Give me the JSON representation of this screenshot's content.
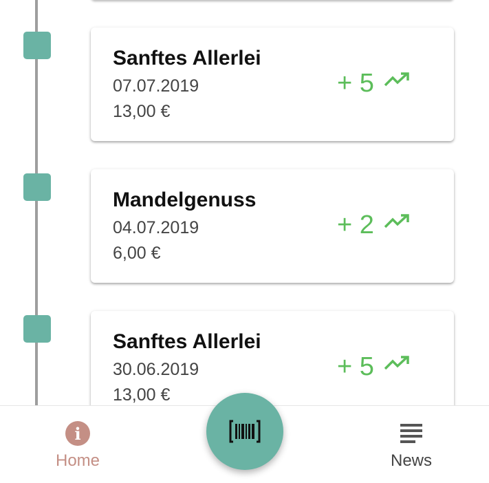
{
  "timeline": {
    "entries": [
      {
        "title": "Sanftes Allerlei",
        "date": "07.07.2019",
        "price": "13,00 €",
        "points": "+ 5",
        "trend_icon": "trending-up-icon"
      },
      {
        "title": "Mandelgenuss",
        "date": "04.07.2019",
        "price": "6,00 €",
        "points": "+ 2",
        "trend_icon": "trending-up-icon"
      },
      {
        "title": "Sanftes Allerlei",
        "date": "30.06.2019",
        "price": "13,00 €",
        "points": "+ 5",
        "trend_icon": "trending-up-icon"
      }
    ]
  },
  "bottom_nav": {
    "home": {
      "label": "Home",
      "icon": "info-icon",
      "icon_glyph": "i",
      "active": true
    },
    "scan": {
      "icon": "barcode-scan-icon"
    },
    "news": {
      "label": "News",
      "icon": "news-list-icon"
    }
  },
  "colors": {
    "accent": "#6ab3a4",
    "positive": "#5cbd5a",
    "active_nav": "#c48f85",
    "timeline_line": "#9e9e9e"
  }
}
